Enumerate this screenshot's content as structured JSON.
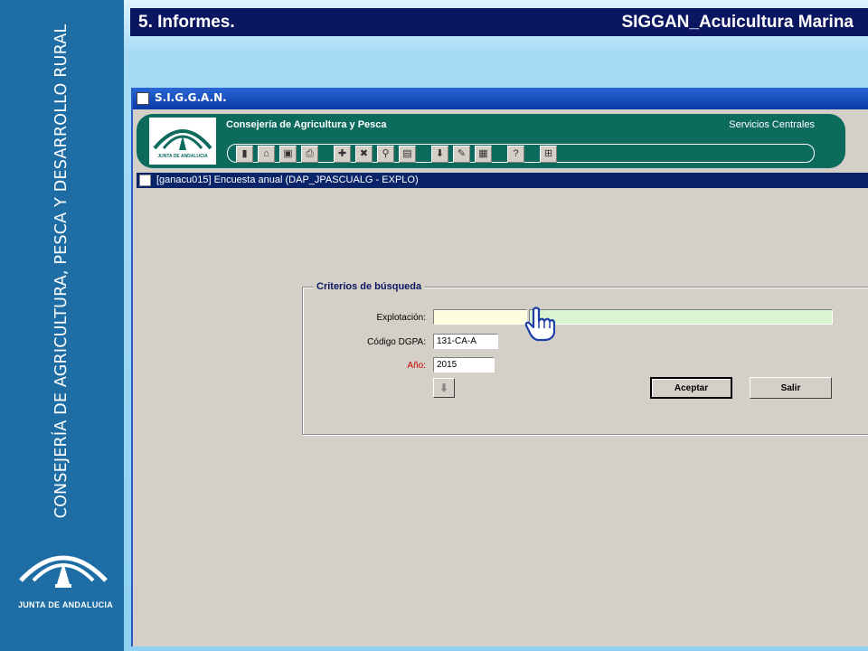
{
  "sidebar": {
    "vertical_text": "CONSEJERÍA DE  AGRICULTURA, PESCA Y DESARROLLO RURAL",
    "logo_text": "JUNTA DE ANDALUCIA"
  },
  "slide": {
    "title_left": "5. Informes.",
    "title_right": "SIGGAN_Acuicultura Marina"
  },
  "app": {
    "window_title": "S.I.G.G.A.N.",
    "header_logo_text": "JUNTA DE ANDALUCIA",
    "organization": "Consejería de Agricultura y Pesca",
    "service": "Servicios Centrales",
    "toolbar_icons": [
      "exit-icon",
      "folder-open-icon",
      "save-icon",
      "print-icon",
      "insert-record-icon",
      "delete-record-icon",
      "find-icon",
      "preview-icon",
      "download-icon",
      "edit-icon",
      "calendar-icon",
      "help-icon",
      "hierarchy-icon"
    ],
    "document_title": "[ganacu015] Encuesta anual   (DAP_JPASCUALG - EXPLO)"
  },
  "search": {
    "legend": "Criterios de búsqueda",
    "explotacion_label": "Explotación:",
    "explotacion_code": "",
    "explotacion_name": "",
    "codigo_label": "Código DGPA:",
    "codigo_value": "131-CA-A",
    "anio_label": "Año:",
    "anio_value": "2015",
    "accept_label": "Aceptar",
    "exit_label": "Salir"
  },
  "colors": {
    "title_bar": "#0a1660",
    "header_band": "#0d6b5e",
    "explotacion_code_bg": "#fffde0",
    "explotacion_name_bg": "#d8f5d0",
    "anio_label_color": "#cc0000"
  }
}
